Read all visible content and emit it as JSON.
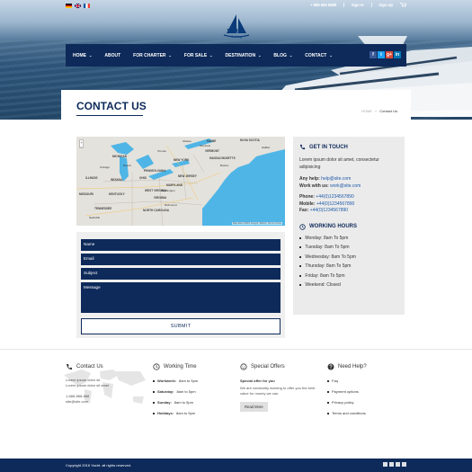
{
  "topbar": {
    "phone": "+ 888 555 8888",
    "sign_in": "Sign In",
    "sign_up": "Sign Up"
  },
  "logo": {
    "name": "Yacht",
    "tagline": "Sailing"
  },
  "nav": {
    "items": [
      {
        "label": "HOME"
      },
      {
        "label": "ABOUT"
      },
      {
        "label": "FOR CHARTER"
      },
      {
        "label": "FOR SALE"
      },
      {
        "label": "DESTINATION"
      },
      {
        "label": "BLOG"
      },
      {
        "label": "CONTACT"
      }
    ],
    "social": [
      "f",
      "t",
      "g+",
      "in"
    ]
  },
  "page": {
    "title": "CONTACT US",
    "breadcrumb_home": "HOME",
    "breadcrumb_sep": "»",
    "breadcrumb_current": "Contact Us"
  },
  "map": {
    "credit": "Map data ©2016 Google, INEGI  |  Terms of Use",
    "labels": {
      "maine": "MAINE",
      "nova_scotia": "NOVA SCOTIA",
      "vermont": "VERMONT",
      "new_york": "NEW YORK",
      "michigan": "MICHIGAN",
      "ohio": "OHIO",
      "pennsylvania": "PENNSYLVANIA",
      "indiana": "INDIANA",
      "illinois": "ILLINOIS",
      "west_virginia": "WEST VIRGINIA",
      "virginia": "VIRGINIA",
      "kentucky": "KENTUCKY",
      "tennessee": "TENNESSEE",
      "north_carolina": "NORTH CAROLINA",
      "missouri": "MISSOURI",
      "maryland": "MARYLAND",
      "massachusetts": "MASSACHUSETTS",
      "new_jersey": "NEW JERSEY"
    },
    "cities": {
      "toronto": "Toronto",
      "ottawa": "Ottawa",
      "montreal": "Montreal",
      "boston": "Boston",
      "detroit": "Detroit",
      "chicago": "Chicago",
      "washington": "Washington",
      "richmond": "Richmond",
      "nashville": "Nashville",
      "halifax": "Halifax"
    }
  },
  "form": {
    "name_placeholder": "Name",
    "email_placeholder": "Email",
    "subject_placeholder": "Subject",
    "message_placeholder": "Message",
    "submit_label": "SUBMIT"
  },
  "info": {
    "get_in_touch_title": "GET IN TOUCH",
    "intro": "Lorem ipsum dolor sit amet, consectetur adipisicing",
    "help_label": "Any help:",
    "help_email": "help@site.com",
    "work_label": "Work with us:",
    "work_email": "work@site.com",
    "phone_label": "Phone:",
    "phone": "+44(0)1234567890",
    "mobile_label": "Mobile:",
    "mobile": "+44(0)1234567890",
    "fax_label": "Fax:",
    "fax": "+44(0)1234567890",
    "hours_title": "WORKING HOURS",
    "hours": [
      "Monday: 8am To 5pm",
      "Tuesday: 8am To 5pm",
      "Wednesday: 8am To 5pm",
      "Thursday: 8am To 5pm",
      "Friday: 8am To 5pm",
      "Weekend: Closed"
    ]
  },
  "footer": {
    "contact": {
      "title": "Contact Us",
      "line1": "Lorem ipsum dolor sit",
      "line2": "Lorem ipsum dolor sit amet",
      "phone": "1-888-888-888",
      "email": "site@site.com"
    },
    "working_time": {
      "title": "Working Time",
      "rows": [
        {
          "day": "Workweek:",
          "time": "8am to 5pm"
        },
        {
          "day": "Saturday:",
          "time": "8am to 5pm"
        },
        {
          "day": "Sunday:",
          "time": "8am to 5pm"
        },
        {
          "day": "Holidays:",
          "time": "8am to 5pm"
        }
      ]
    },
    "special_offers": {
      "title": "Special Offers",
      "heading": "Special offer for you",
      "text": "We are constantly working to offer you the best value for money we can.",
      "button": "Read More"
    },
    "need_help": {
      "title": "Need Help?",
      "links": [
        "Faq",
        "Payment options",
        "Privacy policy",
        "Terms and conditions"
      ]
    },
    "copyright": "Copyright 2016 Yacht. all rights reserved."
  },
  "colors": {
    "primary": "#0e2a5a",
    "link": "#1e5aa8",
    "panel": "#ebebeb"
  }
}
